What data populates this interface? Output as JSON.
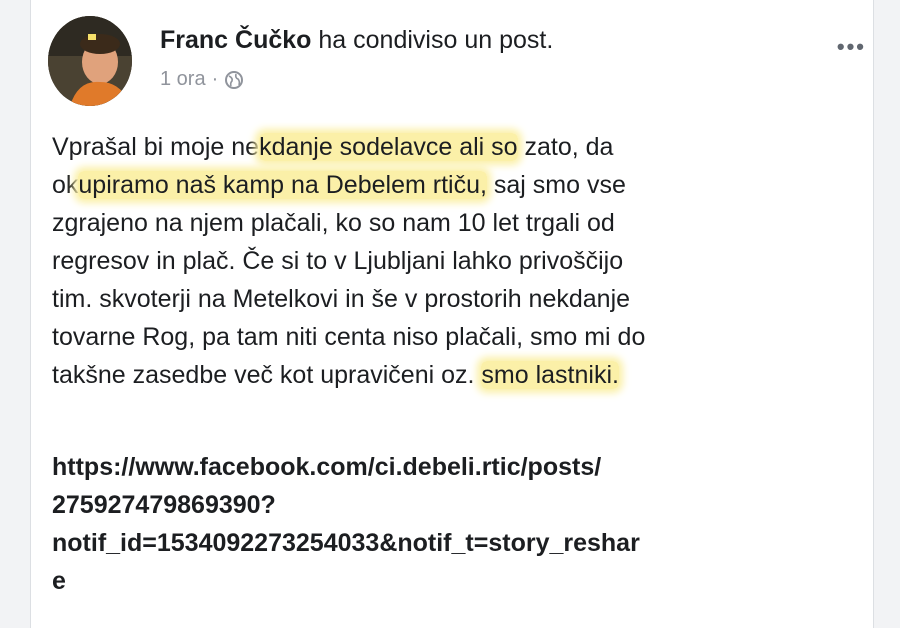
{
  "post": {
    "author_name": "Franc Čučko",
    "action": "ha condiviso un post.",
    "time": "1 ora",
    "separator": "·",
    "privacy_icon": "globe-icon",
    "more_icon": "more-options-icon",
    "more_label": "•••",
    "text_lines": [
      [
        "Vprašal bi moje ne",
        "kdanje sodelavce ali so",
        " zato, da"
      ],
      [
        "ok",
        "upiramo naš kamp na Debelem rtiču,",
        " saj smo vse"
      ],
      [
        "zgrajeno na njem plačali, ko so nam 10 let trgali od"
      ],
      [
        "regresov in plač. Če si to v Ljubljani lahko privoščijo"
      ],
      [
        "tim. skvoterji na Metelkovi in še v prostorih nekdanje"
      ],
      [
        "tovarne Rog, pa tam niti centa niso plačali, smo mi do"
      ],
      [
        "takšne zasedbe več kot upravičeni oz. ",
        "smo lastniki."
      ]
    ],
    "link_lines": [
      "https://www.facebook.com/ci.debeli.rtic/posts/",
      "275927479869390?",
      "notif_id=1534092273254033&notif_t=story_reshar",
      "e"
    ],
    "highlight_color": "#fbf0a8"
  }
}
